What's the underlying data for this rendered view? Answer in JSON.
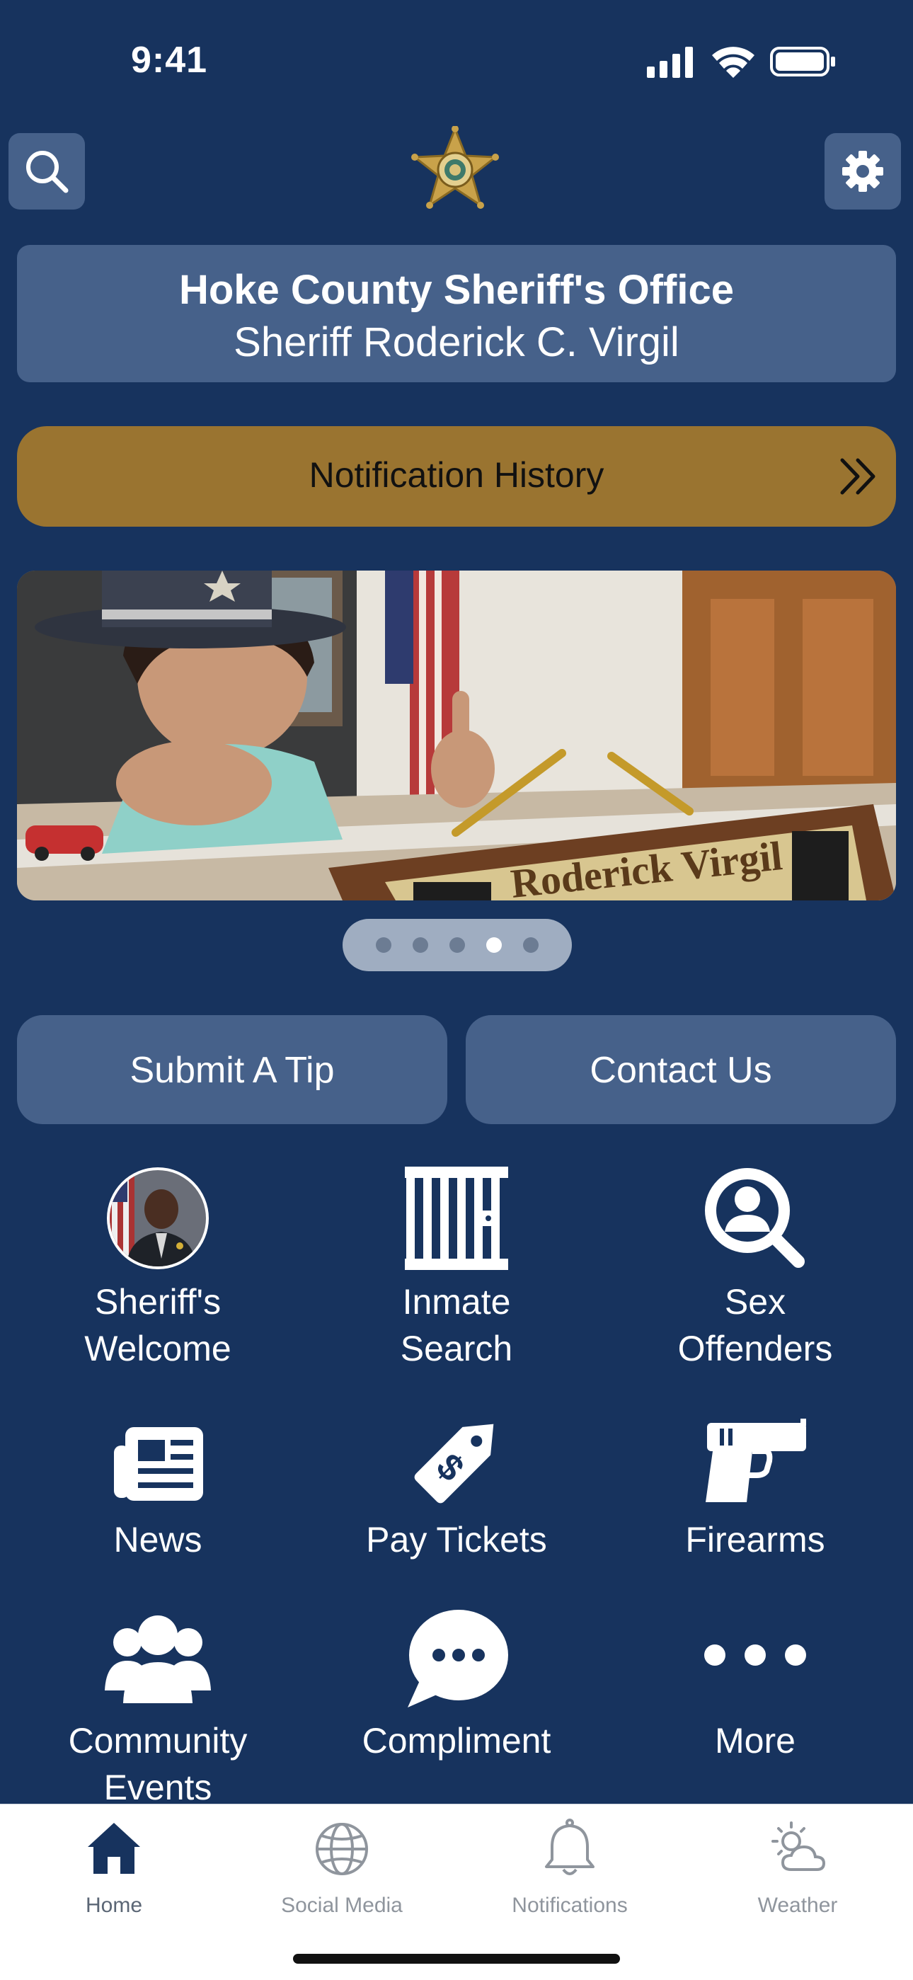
{
  "status": {
    "time": "9:41"
  },
  "header": {
    "title": "Hoke County Sheriff's Office",
    "subtitle": "Sheriff Roderick C. Virgil"
  },
  "notification_history": {
    "label": "Notification History"
  },
  "carousel": {
    "nameplate_text": "Roderick Virgil",
    "page_count": 5,
    "active_index": 3
  },
  "actions": {
    "tip_label": "Submit A Tip",
    "contact_label": "Contact Us"
  },
  "grid": {
    "items": [
      {
        "line1": "Sheriff's",
        "line2": "Welcome",
        "icon": "sheriff-portrait"
      },
      {
        "line1": "Inmate",
        "line2": "Search",
        "icon": "jail-bars-icon"
      },
      {
        "line1": "Sex",
        "line2": "Offenders",
        "icon": "person-search-icon"
      },
      {
        "line1": "News",
        "line2": "",
        "icon": "newspaper-icon"
      },
      {
        "line1": "Pay Tickets",
        "line2": "",
        "icon": "price-tag-icon"
      },
      {
        "line1": "Firearms",
        "line2": "",
        "icon": "pistol-icon"
      },
      {
        "line1": "Community",
        "line2": "Events",
        "icon": "people-group-icon"
      },
      {
        "line1": "Compliment",
        "line2": "",
        "icon": "speech-bubble-icon"
      },
      {
        "line1": "More",
        "line2": "",
        "icon": "ellipsis-icon"
      }
    ]
  },
  "tabbar": {
    "tabs": [
      {
        "label": "Home",
        "icon": "home-icon",
        "active": true
      },
      {
        "label": "Social Media",
        "icon": "globe-icon",
        "active": false
      },
      {
        "label": "Notifications",
        "icon": "bell-icon",
        "active": false
      },
      {
        "label": "Weather",
        "icon": "sun-cloud-icon",
        "active": false
      }
    ]
  },
  "colors": {
    "background": "#17335e",
    "card": "#46618a",
    "gold_button": "#9a7430",
    "tab_active": "#17335e"
  }
}
